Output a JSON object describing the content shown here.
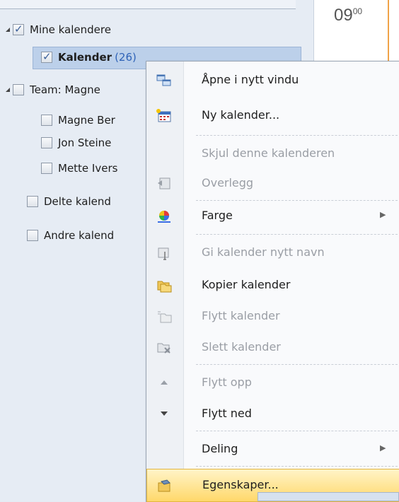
{
  "nav": {
    "groups": [
      {
        "label": "Mine kalendere",
        "checked": true
      },
      {
        "label": "Team: Magne",
        "checked": false
      },
      {
        "label": "Delte kalend",
        "checked": false
      },
      {
        "label": "Andre kalend",
        "checked": false
      }
    ],
    "items": [
      {
        "label": "Kalender",
        "count": "(26)",
        "checked": true
      },
      {
        "label": "Magne Ber",
        "checked": false
      },
      {
        "label": "Jon Steine",
        "checked": false
      },
      {
        "label": "Mette Ivers",
        "checked": false
      }
    ]
  },
  "calendar": {
    "time_hour": "09",
    "time_minutes": "00"
  },
  "menu": {
    "items": [
      {
        "label": "Åpne i nytt vindu",
        "enabled": true,
        "icon": "open-window-icon"
      },
      {
        "label": "Ny kalender...",
        "enabled": true,
        "icon": "new-calendar-icon"
      },
      {
        "label": "Skjul denne kalenderen",
        "enabled": false,
        "icon": ""
      },
      {
        "label": "Overlegg",
        "enabled": false,
        "icon": "overlay-icon"
      },
      {
        "label": "Farge",
        "enabled": true,
        "icon": "color-wheel-icon",
        "submenu": true
      },
      {
        "label": "Gi kalender nytt navn",
        "enabled": false,
        "icon": "rename-icon"
      },
      {
        "label": "Kopier kalender",
        "enabled": true,
        "icon": "copy-folder-icon"
      },
      {
        "label": "Flytt kalender",
        "enabled": false,
        "icon": "move-folder-icon"
      },
      {
        "label": "Slett kalender",
        "enabled": false,
        "icon": "delete-folder-icon"
      },
      {
        "label": "Flytt opp",
        "enabled": false,
        "icon": "arrow-up-icon"
      },
      {
        "label": "Flytt ned",
        "enabled": true,
        "icon": "arrow-down-icon"
      },
      {
        "label": "Deling",
        "enabled": true,
        "icon": "",
        "submenu": true
      },
      {
        "label": "Egenskaper...",
        "enabled": true,
        "icon": "properties-icon",
        "hover": true
      }
    ]
  },
  "colors": {
    "selection": "#bcd0ea",
    "hover": "#ffd86a",
    "accent": "#f0a348"
  }
}
